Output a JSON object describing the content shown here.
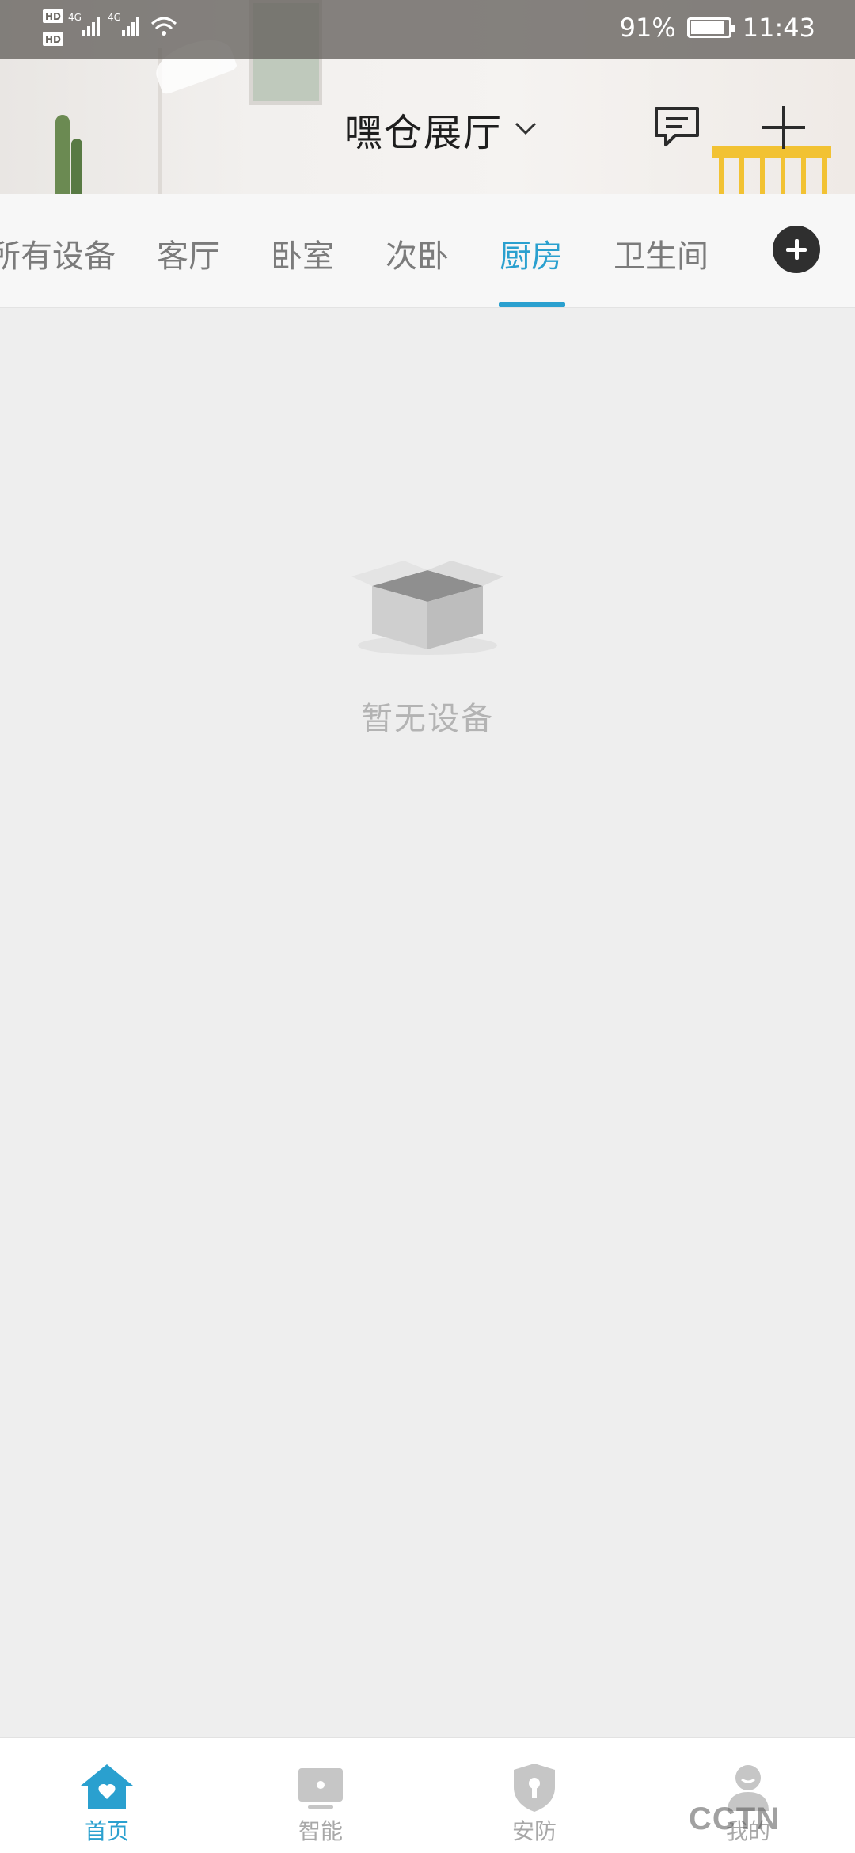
{
  "status_bar": {
    "left_labels": [
      "HD",
      "HD",
      "4G",
      "4G"
    ],
    "battery": "91%",
    "battery_level": 0.91,
    "time": "11:43"
  },
  "header": {
    "title": "嘿仓展厅",
    "title_dropdown_icon": "chevron-down-icon",
    "message_icon": "message-icon",
    "add_icon": "plus-icon"
  },
  "tabs": {
    "items": [
      {
        "label": "所有设备"
      },
      {
        "label": "客厅"
      },
      {
        "label": "卧室"
      },
      {
        "label": "次卧"
      },
      {
        "label": "厨房",
        "active": true
      },
      {
        "label": "卫生间"
      }
    ],
    "add_icon": "plus-circle-icon"
  },
  "empty_state": {
    "icon": "empty-box-icon",
    "text": "暂无设备"
  },
  "bottom_nav": {
    "items": [
      {
        "label": "首页",
        "icon": "home-icon",
        "active": true
      },
      {
        "label": "智能",
        "icon": "smart-icon"
      },
      {
        "label": "安防",
        "icon": "security-shield-icon"
      },
      {
        "label": "我的",
        "icon": "profile-icon"
      }
    ]
  },
  "colors": {
    "accent": "#2aa0cf",
    "background": "#eeeeee",
    "inactive_text": "#7b7b7b"
  },
  "watermark": "CCTN"
}
